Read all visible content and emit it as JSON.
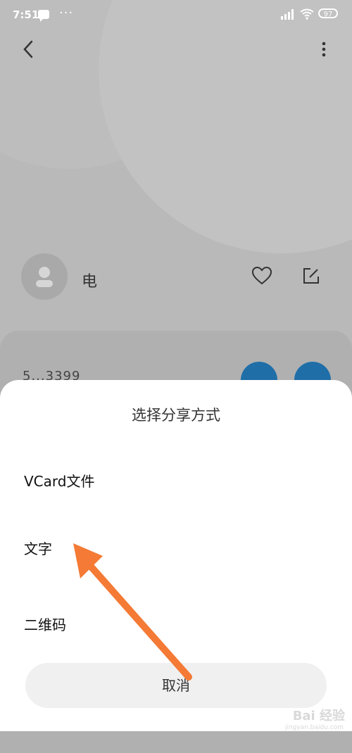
{
  "status_bar": {
    "time": "7:51",
    "battery": "97"
  },
  "contact": {
    "name": "电",
    "number": "5...3399"
  },
  "share_sheet": {
    "title": "选择分享方式",
    "options": [
      "VCard文件",
      "文字",
      "二维码"
    ],
    "cancel_label": "取消"
  },
  "watermark": {
    "text": "Bai 经验",
    "url": "jingyan.baidu.com"
  },
  "colors": {
    "dim_background": "#b9b9b9",
    "sheet_background": "#ffffff",
    "call_button": "#1f6ea8",
    "arrow": "#f47a35"
  }
}
